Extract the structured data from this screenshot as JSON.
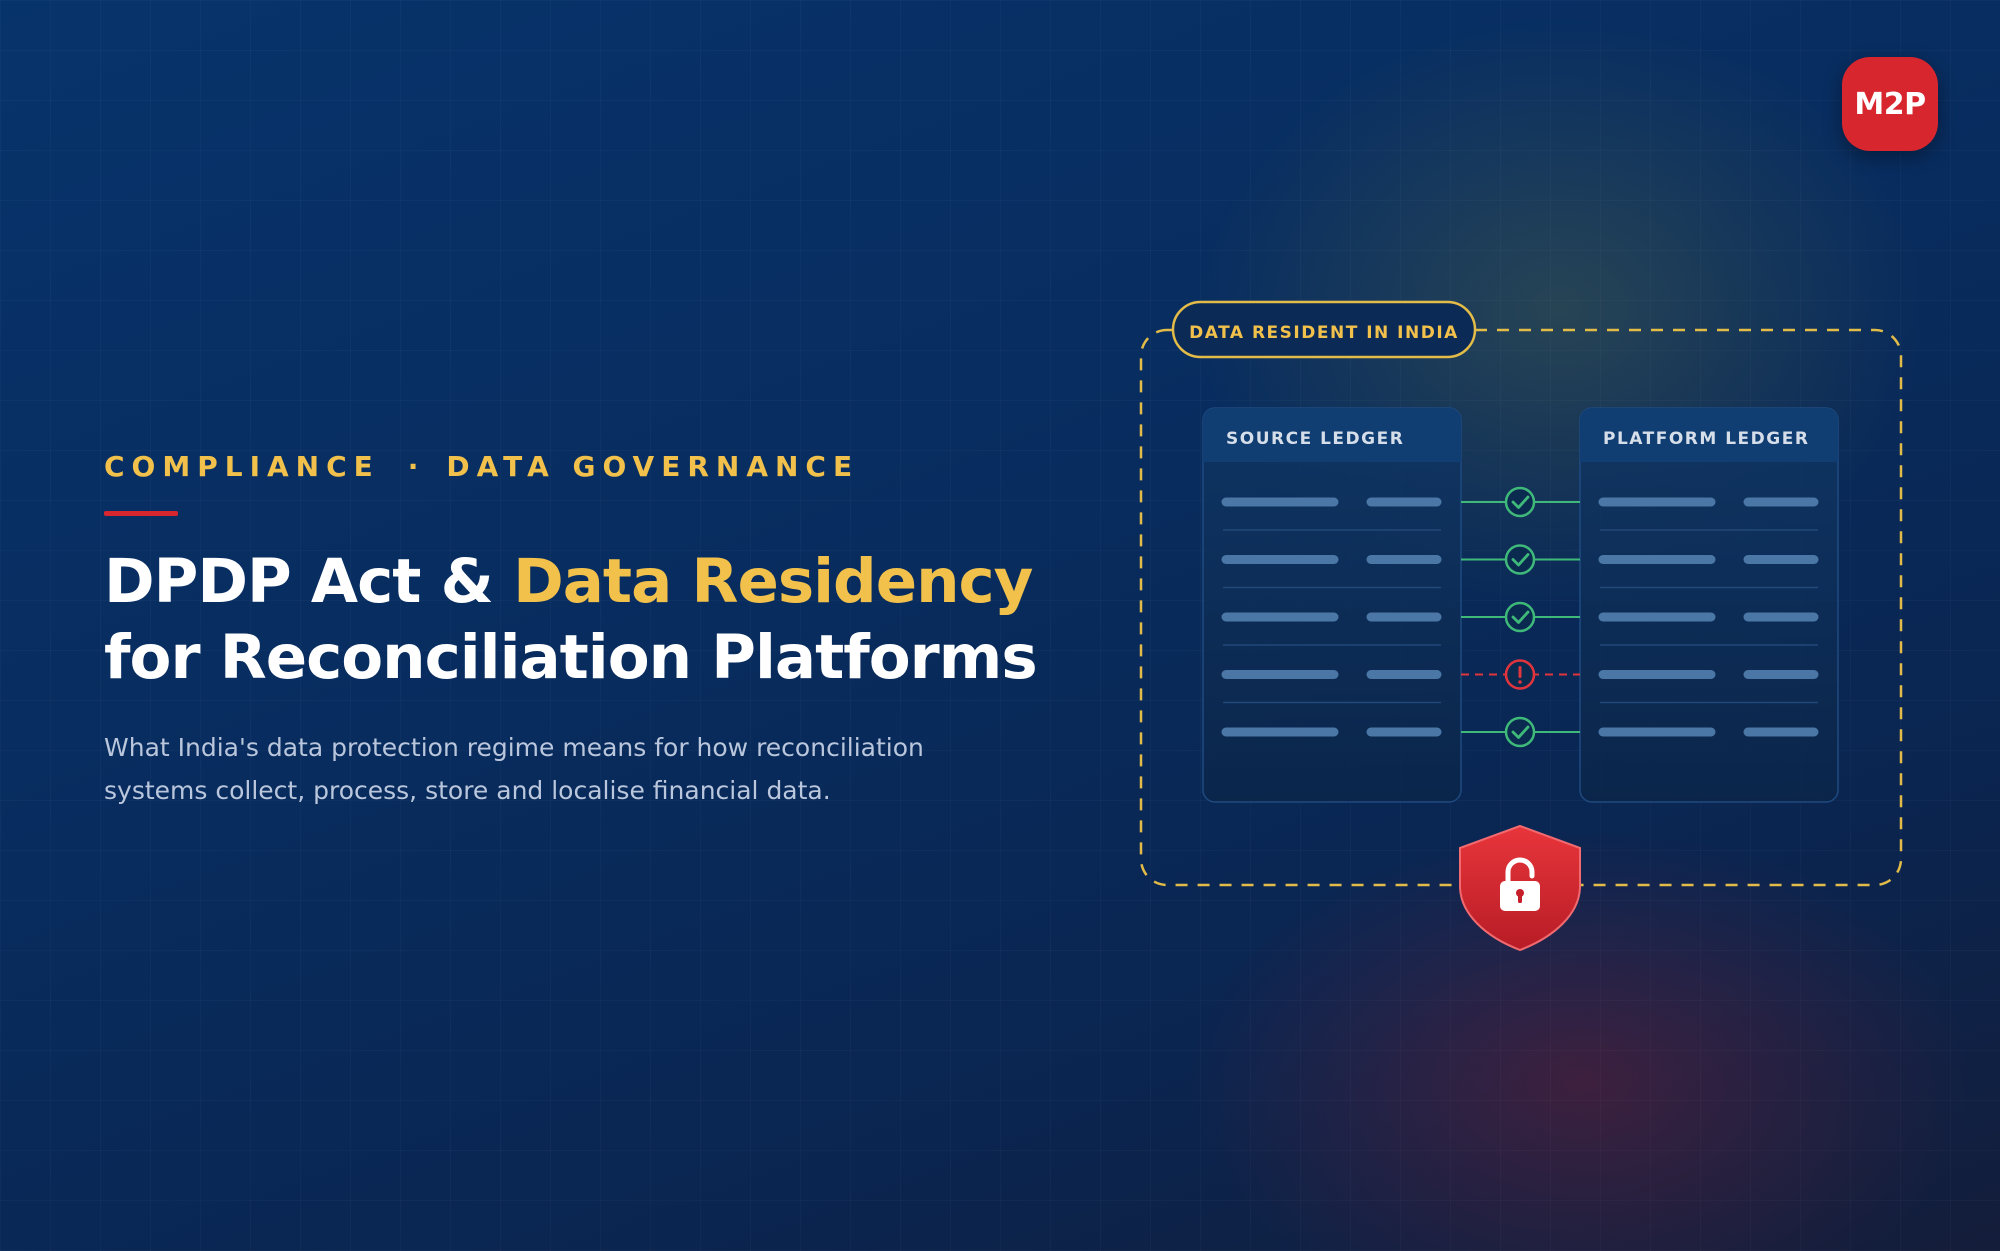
{
  "brand": {
    "logo_text": "M2P",
    "accent": "#f2c14b",
    "brand_red": "#d8262e"
  },
  "eyebrow": {
    "left": "COMPLIANCE",
    "separator": "·",
    "right": "DATA GOVERNANCE"
  },
  "title": {
    "line1_prefix": "DPDP Act & ",
    "line1_highlight": "Data Residency",
    "line2": "for Reconciliation Platforms"
  },
  "subtitle": "What India's data protection regime means for how reconciliation systems collect, process, store and localise financial data.",
  "diagram": {
    "boundary_label": "DATA RESIDENT IN INDIA",
    "left_panel_title": "SOURCE LEDGER",
    "right_panel_title": "PLATFORM LEDGER",
    "rows": [
      "match",
      "match",
      "match",
      "mismatch",
      "match"
    ],
    "shield_icon": "padlock-shield-icon",
    "match_icon": "check-circle-icon",
    "mismatch_icon": "exclamation-circle-icon"
  }
}
